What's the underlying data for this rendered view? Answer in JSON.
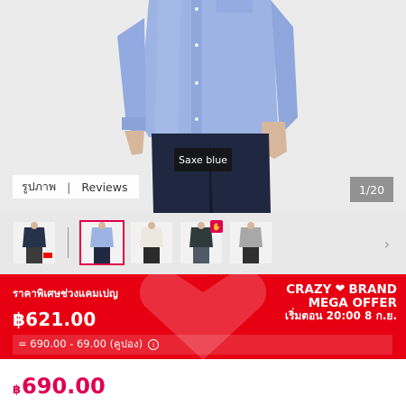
{
  "product": {
    "color_name": "Saxe blue",
    "media_tabs": [
      "รูปภาพ",
      "Reviews"
    ],
    "media_separator": "|",
    "image_counter": "1/20"
  },
  "thumbnails": [
    {
      "label": "thumbnail navy",
      "selected": false,
      "has_logo": true
    },
    {
      "label": "thumbnail saxe blue",
      "selected": true,
      "has_logo": false
    },
    {
      "label": "thumbnail off white",
      "selected": false,
      "has_logo": false
    },
    {
      "label": "thumbnail dark green",
      "selected": false,
      "has_logo": false,
      "badge": true
    },
    {
      "label": "thumbnail gray",
      "selected": false,
      "has_logo": false
    }
  ],
  "promo": {
    "label": "ราคาพิเศษช่วงแคมเปญ",
    "price": "฿621.00",
    "calc": "= 690.00 - 69.00 (คูปอง)",
    "brand_line1_left": "CRAZY",
    "brand_line1_right": "BRAND",
    "brand_line2": "MEGA OFFER",
    "brand_line3": "เริ่มตอน 20:00 8 ก.ย."
  },
  "regular_price": {
    "currency": "฿",
    "amount": "690.00"
  },
  "colors": {
    "promo_red": "#e60012",
    "accent_pink": "#e0004d",
    "shirt_blue": "#9db3e3",
    "pants_navy": "#1f2840"
  },
  "icons": {
    "info": "info-icon",
    "next": "chevron-right-icon",
    "heart": "heart-icon",
    "badge": "hand-badge-icon"
  }
}
